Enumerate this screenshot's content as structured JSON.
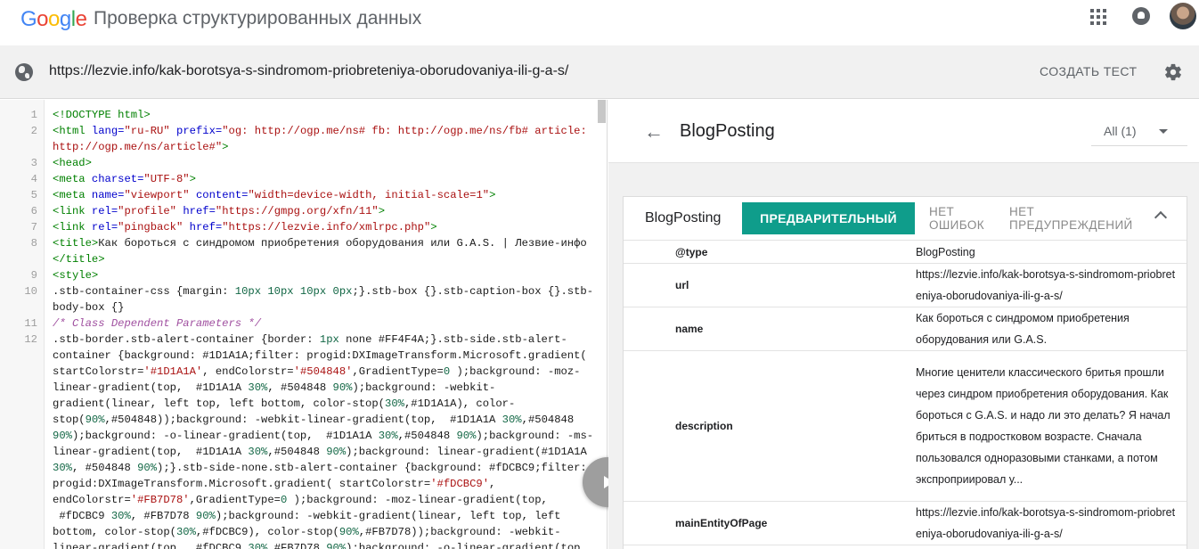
{
  "header": {
    "logo_letters": [
      {
        "ch": "G",
        "color": "#4285F4"
      },
      {
        "ch": "o",
        "color": "#EA4335"
      },
      {
        "ch": "o",
        "color": "#FBBC05"
      },
      {
        "ch": "g",
        "color": "#4285F4"
      },
      {
        "ch": "l",
        "color": "#34A853"
      },
      {
        "ch": "e",
        "color": "#EA4335"
      }
    ],
    "title": "Проверка структурированных данных",
    "apps_icon": "apps-grid-icon",
    "notifications_icon": "bell-icon"
  },
  "urlbar": {
    "url": "https://lezvie.info/kak-borotsya-s-sindromom-priobreteniya-oborudovaniya-ili-g-a-s/",
    "create_test_label": "СОЗДАТЬ ТЕСТ"
  },
  "code": {
    "lines": [
      {
        "n": "1",
        "html": "<span class=\"tag\">&lt;!DOCTYPE html&gt;</span>"
      },
      {
        "n": "2",
        "html": "<span class=\"tag\">&lt;html</span> <span class=\"attr\">lang=</span><span class=\"val\">\"ru-RU\"</span> <span class=\"attr\">prefix=</span><span class=\"val\">\"og: http://ogp.me/ns# fb: http://ogp.me/ns/fb# article:</span>"
      },
      {
        "n": "",
        "html": "<span class=\"val\">http://ogp.me/ns/article#\"</span><span class=\"tag\">&gt;</span>"
      },
      {
        "n": "3",
        "html": "<span class=\"tag\">&lt;head&gt;</span>"
      },
      {
        "n": "4",
        "html": "<span class=\"tag\">&lt;meta</span> <span class=\"attr\">charset=</span><span class=\"val\">\"UTF-8\"</span><span class=\"tag\">&gt;</span>"
      },
      {
        "n": "5",
        "html": "<span class=\"tag\">&lt;meta</span> <span class=\"attr\">name=</span><span class=\"val\">\"viewport\"</span> <span class=\"attr\">content=</span><span class=\"val\">\"width=device-width, initial-scale=1\"</span><span class=\"tag\">&gt;</span>"
      },
      {
        "n": "6",
        "html": "<span class=\"tag\">&lt;link</span> <span class=\"attr\">rel=</span><span class=\"val\">\"profile\"</span> <span class=\"attr\">href=</span><span class=\"val\">\"https://gmpg.org/xfn/11\"</span><span class=\"tag\">&gt;</span>"
      },
      {
        "n": "7",
        "html": "<span class=\"tag\">&lt;link</span> <span class=\"attr\">rel=</span><span class=\"val\">\"pingback\"</span> <span class=\"attr\">href=</span><span class=\"val\">\"https://lezvie.info/xmlrpc.php\"</span><span class=\"tag\">&gt;</span>"
      },
      {
        "n": "8",
        "html": "<span class=\"tag\">&lt;title&gt;</span>Как бороться с синдромом приобретения оборудования или G.A.S. | Лезвие-инфо"
      },
      {
        "n": "",
        "html": "<span class=\"tag\">&lt;/title&gt;</span>"
      },
      {
        "n": "9",
        "html": "<span class=\"tag\">&lt;style&gt;</span>"
      },
      {
        "n": "10",
        "html": ".stb-container-css {margin: <span class=\"num\">10px 10px 10px 0px</span>;}.stb-box {}.stb-caption-box {}.stb-"
      },
      {
        "n": "",
        "html": "body-box {}"
      },
      {
        "n": "11",
        "html": "<span class=\"cmt\">/* Class Dependent Parameters */</span>"
      },
      {
        "n": "12",
        "html": ".stb-border.stb-alert-container {border: <span class=\"num\">1px</span> none #FF4F4A;}.stb-side.stb-alert-"
      },
      {
        "n": "",
        "html": "container {background: #1D1A1A;filter: progid:DXImageTransform.Microsoft.gradient("
      },
      {
        "n": "",
        "html": "startColorstr=<span class=\"val\">'#1D1A1A'</span>, endColorstr=<span class=\"val\">'#504848'</span>,GradientType=<span class=\"num\">0</span> );background: -moz-"
      },
      {
        "n": "",
        "html": "linear-gradient(top,  #1D1A1A <span class=\"num\">30%</span>, #504848 <span class=\"num\">90%</span>);background: -webkit-"
      },
      {
        "n": "",
        "html": "gradient(linear, left top, left bottom, color-stop(<span class=\"num\">30%</span>,#1D1A1A), color-"
      },
      {
        "n": "",
        "html": "stop(<span class=\"num\">90%</span>,#504848));background: -webkit-linear-gradient(top,  #1D1A1A <span class=\"num\">30%</span>,#504848"
      },
      {
        "n": "",
        "html": "<span class=\"num\">90%</span>);background: -o-linear-gradient(top,  #1D1A1A <span class=\"num\">30%</span>,#504848 <span class=\"num\">90%</span>);background: -ms-"
      },
      {
        "n": "",
        "html": "linear-gradient(top,  #1D1A1A <span class=\"num\">30%</span>,#504848 <span class=\"num\">90%</span>);background: linear-gradient(#1D1A1A"
      },
      {
        "n": "",
        "html": "<span class=\"num\">30%</span>, #504848 <span class=\"num\">90%</span>);}.stb-side-none.stb-alert-container {background: #fDCBC9;filter:"
      },
      {
        "n": "",
        "html": "progid:DXImageTransform.Microsoft.gradient( startColorstr=<span class=\"val\">'#fDCBC9'</span>,"
      },
      {
        "n": "",
        "html": "endColorstr=<span class=\"val\">'#FB7D78'</span>,GradientType=<span class=\"num\">0</span> );background: -moz-linear-gradient(top,"
      },
      {
        "n": "",
        "html": " #fDCBC9 <span class=\"num\">30%</span>, #FB7D78 <span class=\"num\">90%</span>);background: -webkit-gradient(linear, left top, left"
      },
      {
        "n": "",
        "html": "bottom, color-stop(<span class=\"num\">30%</span>,#fDCBC9), color-stop(<span class=\"num\">90%</span>,#FB7D78));background: -webkit-"
      },
      {
        "n": "",
        "html": "linear-gradient(top,  #fDCBC9 <span class=\"num\">30%</span>,#FB7D78 <span class=\"num\">90%</span>);background: -o-linear-gradient(top,"
      }
    ]
  },
  "results": {
    "title": "BlogPosting",
    "filter_label": "All (1)",
    "card": {
      "type": "BlogPosting",
      "preview_label": "ПРЕДВАРИТЕЛЬНЫЙ",
      "errors_label": [
        "НЕТ",
        "ОШИБОК"
      ],
      "warnings_label": [
        "НЕТ",
        "ПРЕДУПРЕЖДЕНИЙ"
      ],
      "accent_color": "#0f9d8b"
    },
    "properties": [
      {
        "key": "@type",
        "value": "BlogPosting"
      },
      {
        "key": "url",
        "value": "https://lezvie.info/kak-borotsya-s-sindromom-priobreteniya-oborudovaniya-ili-g-a-s/"
      },
      {
        "key": "name",
        "value": "Как бороться с синдромом приобретения оборудования или G.A.S."
      },
      {
        "key": "description",
        "value": "Многие ценители классического бритья прошли через синдром приобретения оборудования. Как бороться с G.A.S. и надо ли это делать? Я начал бриться в подростковом возрасте. Сначала пользовался одноразовыми станками, а потом экспроприировал у..."
      },
      {
        "key": "mainEntityOfPage",
        "value": "https://lezvie.info/kak-borotsya-s-sindromom-priobreteniya-oborudovaniya-ili-g-a-s/"
      }
    ]
  }
}
